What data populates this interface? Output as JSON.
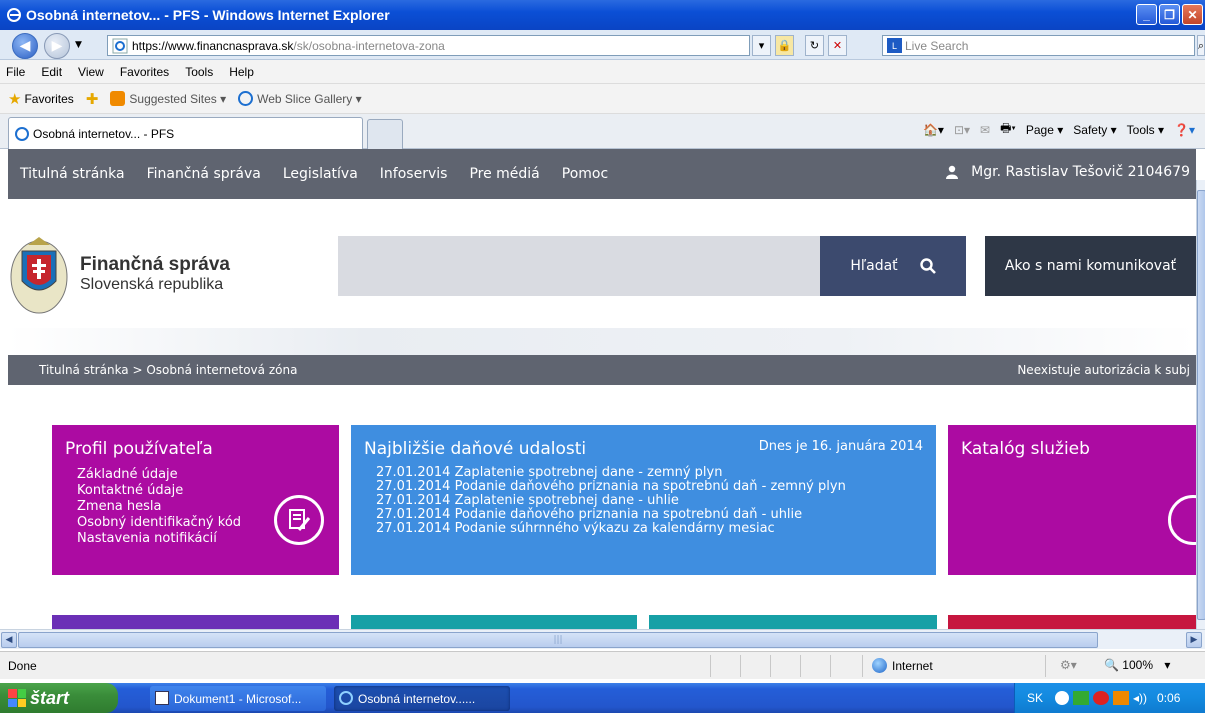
{
  "window": {
    "title": "Osobná internetov... - PFS - Windows Internet Explorer"
  },
  "address": {
    "url_prefix": "https://www.",
    "url_domain": "financnasprava.sk",
    "url_path": "/sk/osobna-internetova-zona",
    "search_placeholder": "Live Search"
  },
  "menu": [
    "File",
    "Edit",
    "View",
    "Favorites",
    "Tools",
    "Help"
  ],
  "favorites": {
    "label": "Favorites",
    "suggested": "Suggested Sites ▾",
    "webslice": "Web Slice Gallery ▾"
  },
  "tab": {
    "active_label": "Osobná internetov... - PFS"
  },
  "commandbar": {
    "page": "Page ▾",
    "safety": "Safety ▾",
    "tools": "Tools ▾"
  },
  "site": {
    "nav": [
      "Titulná stránka",
      "Finančná správa",
      "Legislatíva",
      "Infoservis",
      "Pre médiá",
      "Pomoc"
    ],
    "user": "Mgr. Rastislav Tešovič 2104679",
    "logo_line1": "Finančná správa",
    "logo_line2": "Slovenská republika",
    "search_button": "Hľadať",
    "contact_button": "Ako s nami komunikovať",
    "breadcrumb": "Titulná stránka > Osobná internetová zóna",
    "noauth": "Neexistuje autorizácia k subj",
    "profile": {
      "title": "Profil používateľa",
      "links": [
        "Základné údaje",
        "Kontaktné údaje",
        "Zmena hesla",
        "Osobný identifikačný kód",
        "Nastavenia notifikácií"
      ]
    },
    "events": {
      "title": "Najbližšie daňové udalosti",
      "date": "Dnes je 16. januára 2014",
      "items": [
        "27.01.2014 Zaplatenie spotrebnej dane - zemný plyn",
        "27.01.2014 Podanie daňového priznania na spotrebnú daň - zemný plyn",
        "27.01.2014 Zaplatenie spotrebnej dane - uhlie",
        "27.01.2014 Podanie daňového priznania na spotrebnú daň - uhlie",
        "27.01.2014 Podanie súhrnného výkazu za kalendárny mesiac"
      ]
    },
    "catalog": {
      "title": "Katalóg služieb"
    }
  },
  "status": {
    "text": "Done",
    "zone": "Internet",
    "zoom": "100%"
  },
  "taskbar": {
    "start": "štart",
    "items": [
      "Dokument1 - Microsof...",
      "Osobná internetov......"
    ],
    "lang": "SK",
    "clock": "0:06"
  },
  "colors": {
    "nav_bg": "#5f6470",
    "tile_purple": "#ac0ba2",
    "tile_blue": "#3f8ee0",
    "search_btn": "#3c4a6e"
  }
}
